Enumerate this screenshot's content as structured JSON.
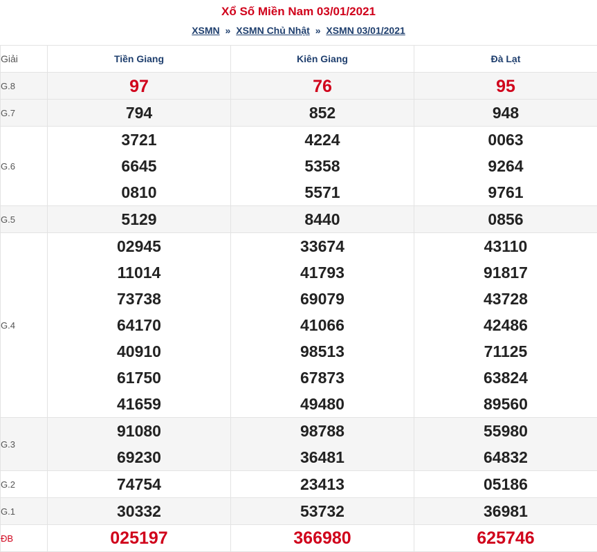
{
  "header": {
    "title": "Xổ Số Miền Nam 03/01/2021",
    "breadcrumb": [
      "XSMN",
      "XSMN Chủ Nhật",
      "XSMN 03/01/2021"
    ],
    "separator": "»"
  },
  "table": {
    "col_label": "Giải",
    "provinces": [
      "Tiền Giang",
      "Kiên Giang",
      "Đà Lạt"
    ],
    "rows": [
      {
        "label": "G.8",
        "values": [
          [
            "97"
          ],
          [
            "76"
          ],
          [
            "95"
          ]
        ]
      },
      {
        "label": "G.7",
        "values": [
          [
            "794"
          ],
          [
            "852"
          ],
          [
            "948"
          ]
        ]
      },
      {
        "label": "G.6",
        "values": [
          [
            "3721",
            "6645",
            "0810"
          ],
          [
            "4224",
            "5358",
            "5571"
          ],
          [
            "0063",
            "9264",
            "9761"
          ]
        ]
      },
      {
        "label": "G.5",
        "values": [
          [
            "5129"
          ],
          [
            "8440"
          ],
          [
            "0856"
          ]
        ]
      },
      {
        "label": "G.4",
        "values": [
          [
            "02945",
            "11014",
            "73738",
            "64170",
            "40910",
            "61750",
            "41659"
          ],
          [
            "33674",
            "41793",
            "69079",
            "41066",
            "98513",
            "67873",
            "49480"
          ],
          [
            "43110",
            "91817",
            "43728",
            "42486",
            "71125",
            "63824",
            "89560"
          ]
        ]
      },
      {
        "label": "G.3",
        "values": [
          [
            "91080",
            "69230"
          ],
          [
            "98788",
            "36481"
          ],
          [
            "55980",
            "64832"
          ]
        ]
      },
      {
        "label": "G.2",
        "values": [
          [
            "74754"
          ],
          [
            "23413"
          ],
          [
            "05186"
          ]
        ]
      },
      {
        "label": "G.1",
        "values": [
          [
            "30332"
          ],
          [
            "53732"
          ],
          [
            "36981"
          ]
        ]
      },
      {
        "label": "ĐB",
        "values": [
          [
            "025197"
          ],
          [
            "366980"
          ],
          [
            "625746"
          ]
        ]
      }
    ]
  },
  "colors": {
    "accent_red": "#d0021b",
    "link_blue": "#1f3f6e",
    "row_alt": "#f5f5f5"
  }
}
